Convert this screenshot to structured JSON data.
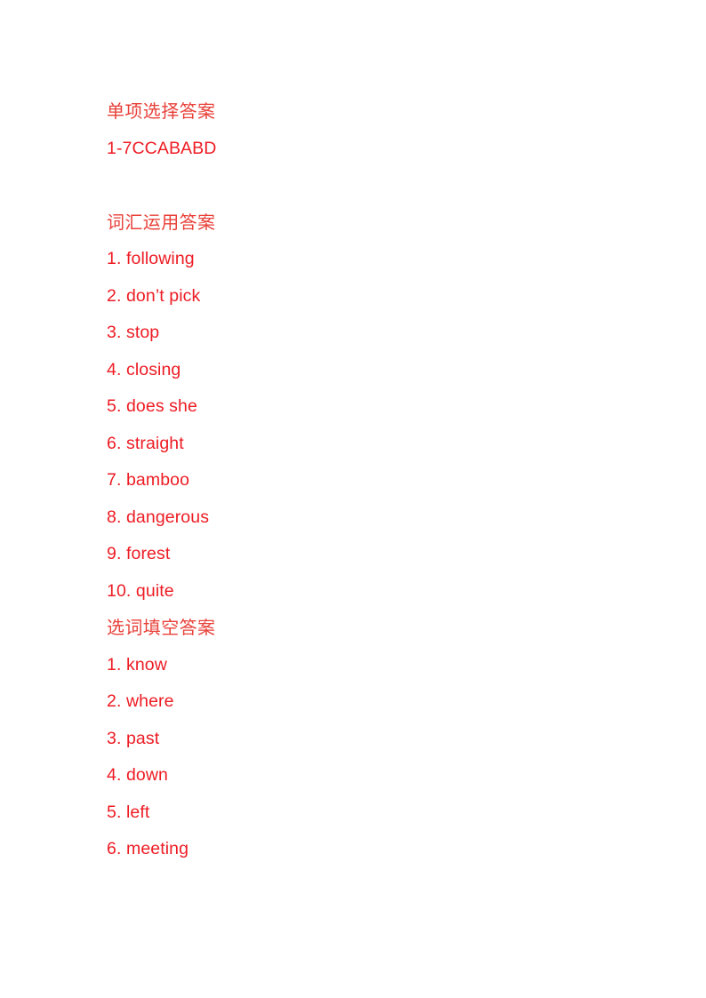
{
  "document": {
    "background_color": "#ffffff",
    "heading_color": "#e8413a",
    "answer_color": "#ed1c24",
    "sections": [
      {
        "heading": "单项选择答案",
        "answers": [
          "1-7CCABABD"
        ]
      },
      {
        "heading": "词汇运用答案",
        "answers": [
          "1. following",
          "2. don’t pick",
          "3. stop",
          "4. closing",
          "5. does she",
          "6. straight",
          "7. bamboo",
          "8. dangerous",
          "9. forest",
          "10. quite"
        ]
      },
      {
        "heading": "选词填空答案",
        "answers": [
          "1. know",
          "2. where",
          "3. past",
          "4. down",
          "5. left",
          "6. meeting"
        ]
      }
    ]
  }
}
